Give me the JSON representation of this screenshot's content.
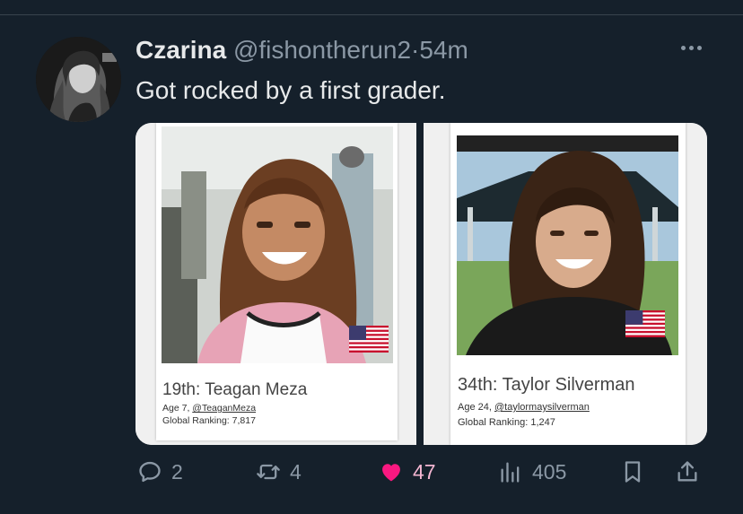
{
  "tweet": {
    "display_name": "Czarina",
    "handle": "@fishontherun2",
    "separator": "·",
    "time": "54m",
    "text": "Got rocked by a first grader."
  },
  "cards": [
    {
      "rank_title": "19th: Teagan Meza",
      "age_text": "Age 7,",
      "age_link": "@TeaganMeza",
      "ranking_text": "Global Ranking: 7,817",
      "flag": "us-flag"
    },
    {
      "rank_title": "34th: Taylor Silverman",
      "age_text": "Age 24,",
      "age_link": "@taylormaysilverman",
      "ranking_text": "Global Ranking: 1,247",
      "flag": "us-flag"
    }
  ],
  "actions": {
    "replies": "2",
    "retweets": "4",
    "likes": "47",
    "views": "405"
  },
  "colors": {
    "background": "#15202b",
    "muted": "#8b98a5",
    "like": "#f91880"
  }
}
